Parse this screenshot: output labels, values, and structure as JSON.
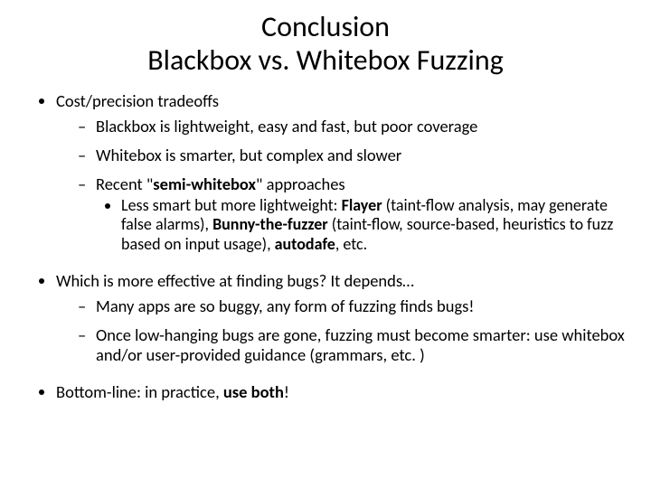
{
  "title_l1": "Conclusion",
  "title_l2": "Blackbox vs. Whitebox Fuzzing",
  "b1": "Cost/precision tradeoffs",
  "b1_s1": "Blackbox is lightweight, easy and fast, but poor coverage",
  "b1_s2": "Whitebox is smarter, but complex and slower",
  "b1_s3_a": "Recent \"",
  "b1_s3_b": "semi-whitebox",
  "b1_s3_c": "\" approaches",
  "b1_s3_i_a": "Less smart but more lightweight: ",
  "b1_s3_i_b": "Flayer",
  "b1_s3_i_c": " (taint-flow analysis, may generate false alarms), ",
  "b1_s3_i_d": "Bunny-the-fuzzer",
  "b1_s3_i_e": " (taint-flow, source-based, heuristics to fuzz based on input usage), ",
  "b1_s3_i_f": "autodafe",
  "b1_s3_i_g": ", etc.",
  "b2": "Which is more effective at finding bugs? It depends…",
  "b2_s1": "Many apps are so buggy, any form of fuzzing finds bugs!",
  "b2_s2": "Once low-hanging bugs are gone, fuzzing must become smarter: use whitebox and/or user-provided guidance (grammars, etc. )",
  "b3_a": "Bottom-line: in practice, ",
  "b3_b": "use both",
  "b3_c": "!"
}
